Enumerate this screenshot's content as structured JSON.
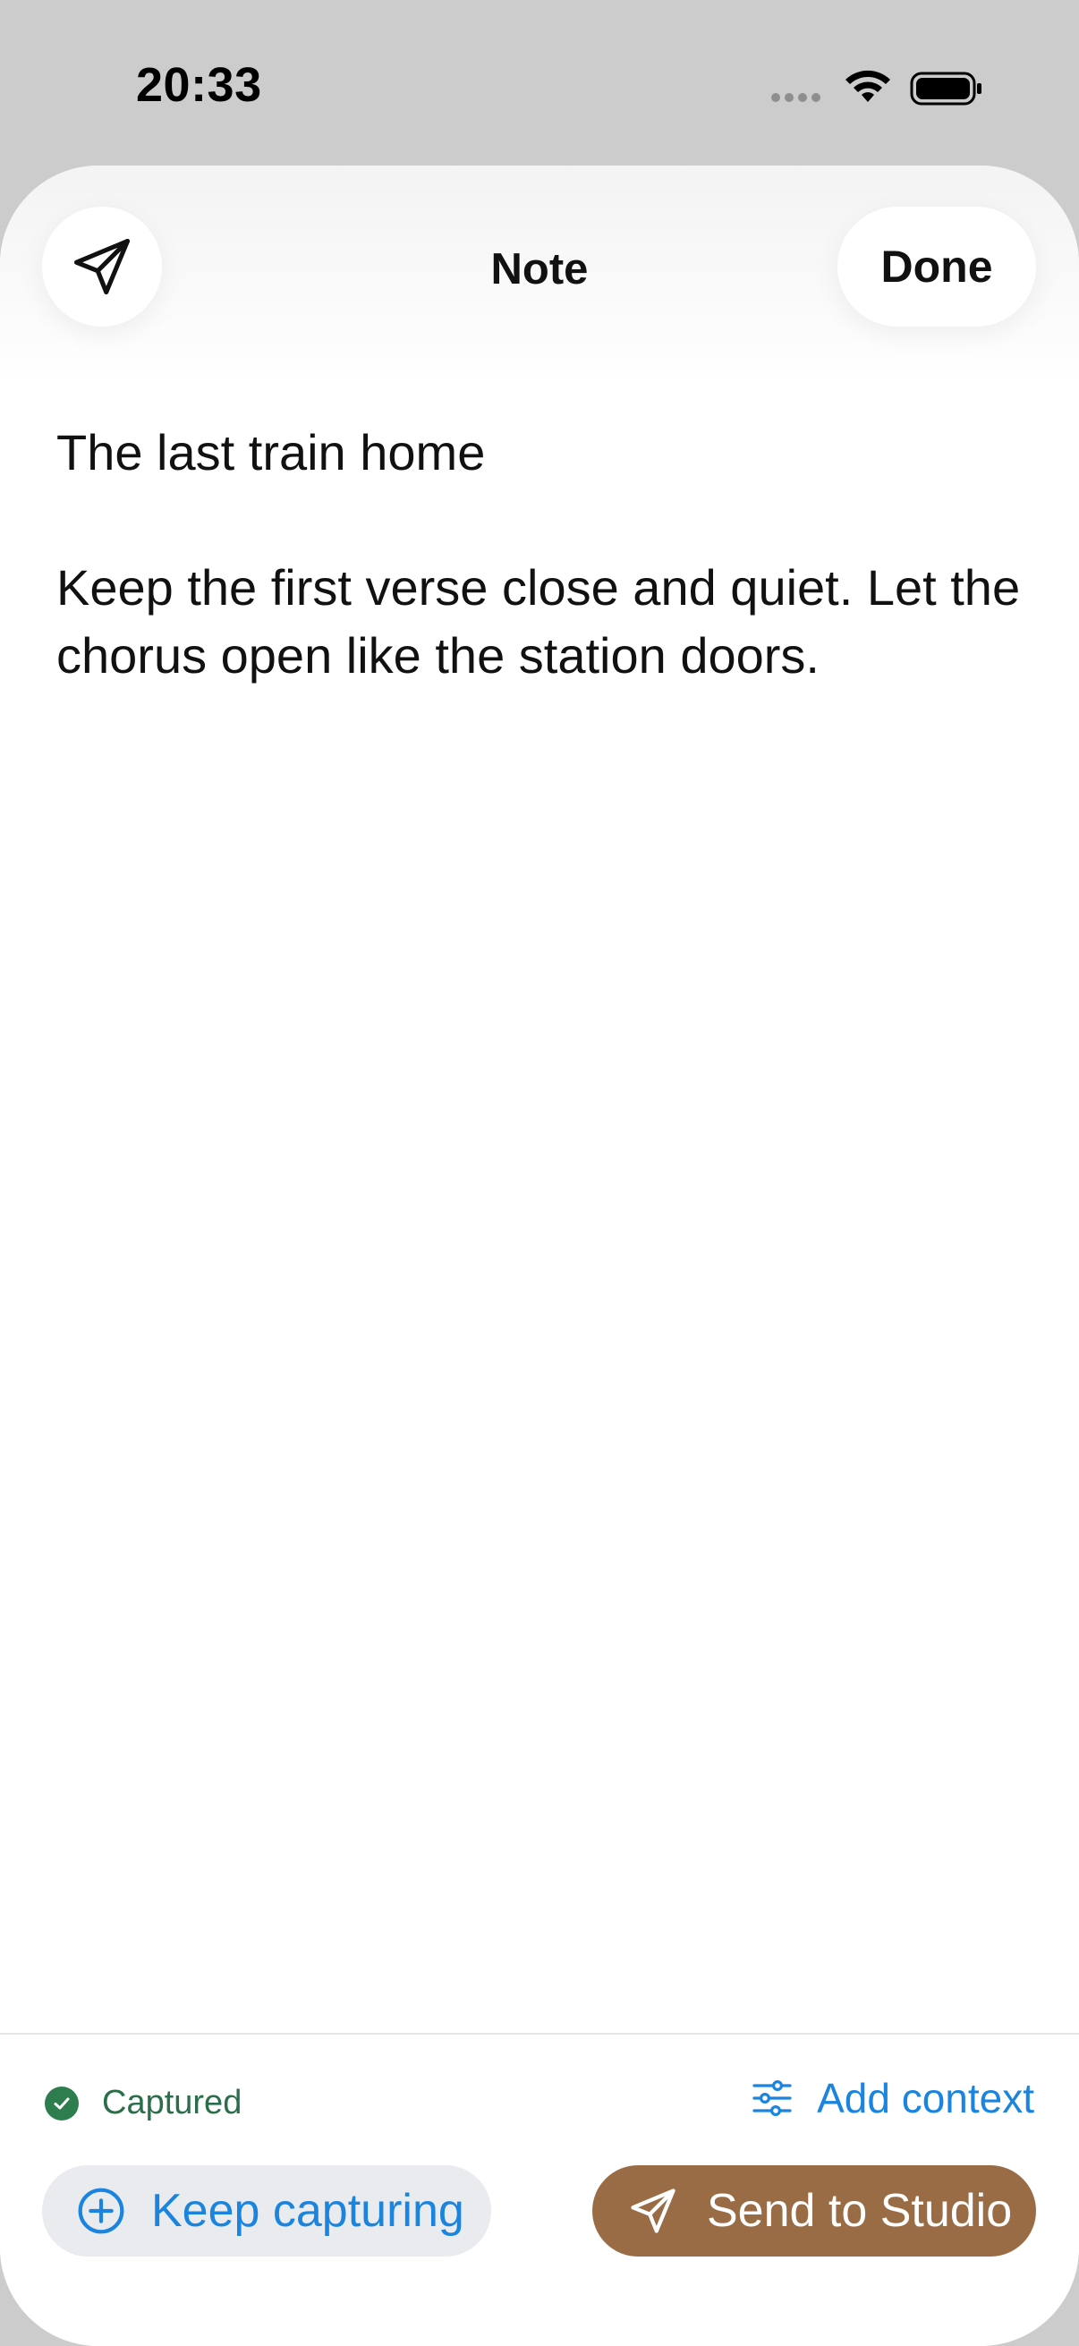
{
  "status_bar": {
    "time": "20:33"
  },
  "header": {
    "title": "Note",
    "done_label": "Done"
  },
  "note": {
    "title": "The last train home",
    "body": "Keep the first verse close and quiet. Let the chorus open like the station doors."
  },
  "footer": {
    "status": "Captured",
    "add_context_label": "Add context",
    "keep_capturing_label": "Keep capturing",
    "send_label": "Send to Studio"
  },
  "colors": {
    "accent_blue": "#1a84de",
    "captured_green": "#2e7d4f",
    "send_brown": "#9a6c45",
    "backdrop_gray": "#cccccc"
  },
  "icons": {
    "share": "paper-plane",
    "captured": "check-circle",
    "add_context": "sliders",
    "keep_capturing": "plus-circle",
    "send": "paper-plane"
  }
}
